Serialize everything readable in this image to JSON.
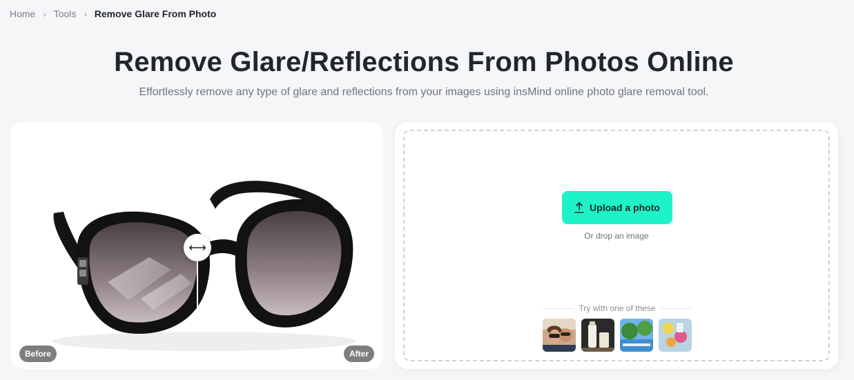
{
  "breadcrumb": {
    "home": "Home",
    "tools": "Tools",
    "current": "Remove Glare From Photo"
  },
  "hero": {
    "title": "Remove Glare/Reflections From Photos Online",
    "subtitle": "Effortlessly remove any type of glare and reflections from your images using insMind online photo glare removal tool."
  },
  "preview": {
    "before_label": "Before",
    "after_label": "After",
    "handle_icon": "left-right-arrow-icon",
    "handle_glyph": "⟷",
    "slider_position": 0.5
  },
  "upload": {
    "button_label": "Upload a photo",
    "button_icon": "upload-arrow-icon",
    "drop_hint": "Or drop an image",
    "try_label": "Try with one of these",
    "samples": [
      "couple-selfie",
      "milk-bottles",
      "beach-trees",
      "fruit-drinks"
    ]
  },
  "colors": {
    "accent": "#1ef2c8",
    "page_bg": "#f5f6f8",
    "card_bg": "#ffffff",
    "tag_bg": "#5a5a5a"
  }
}
